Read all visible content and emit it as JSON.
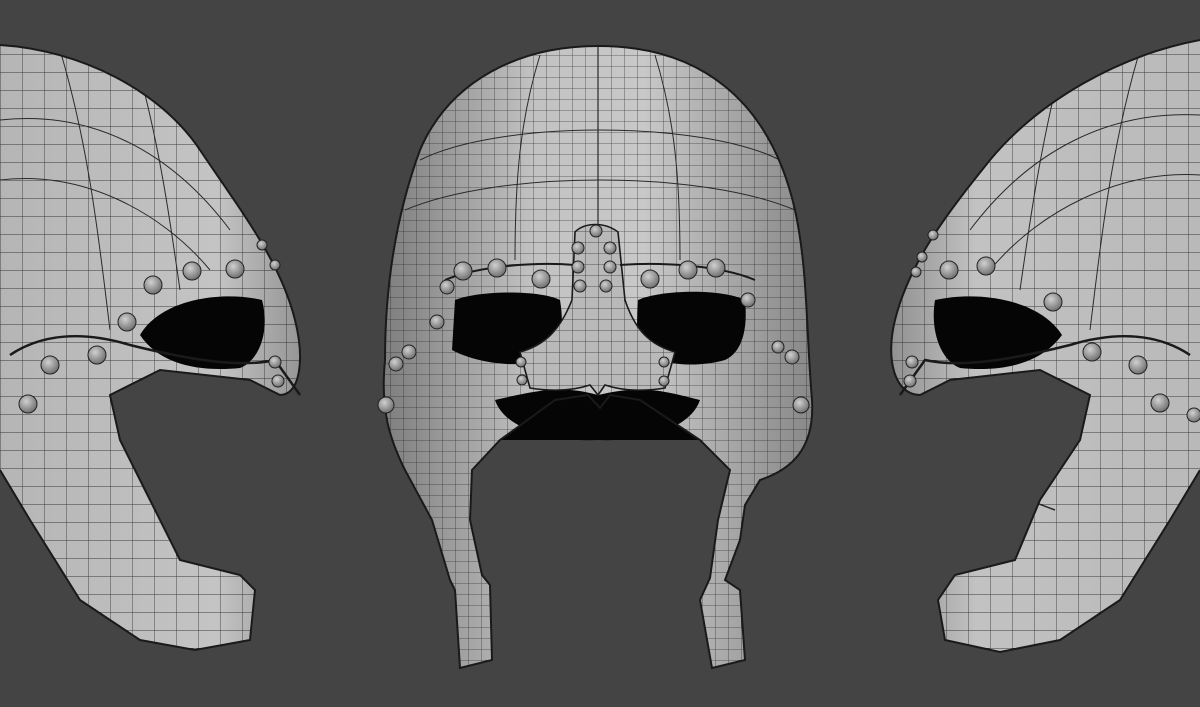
{
  "viewport": {
    "background": "#444444",
    "mesh_fill": "#bdbdbd",
    "mesh_shade": "#8f8f8f",
    "wire_color": "#1e1e1e",
    "hole_color": "#050505"
  },
  "scene": {
    "subject": "helmet-wireframe",
    "views": [
      "left-side",
      "front",
      "right-side"
    ]
  }
}
